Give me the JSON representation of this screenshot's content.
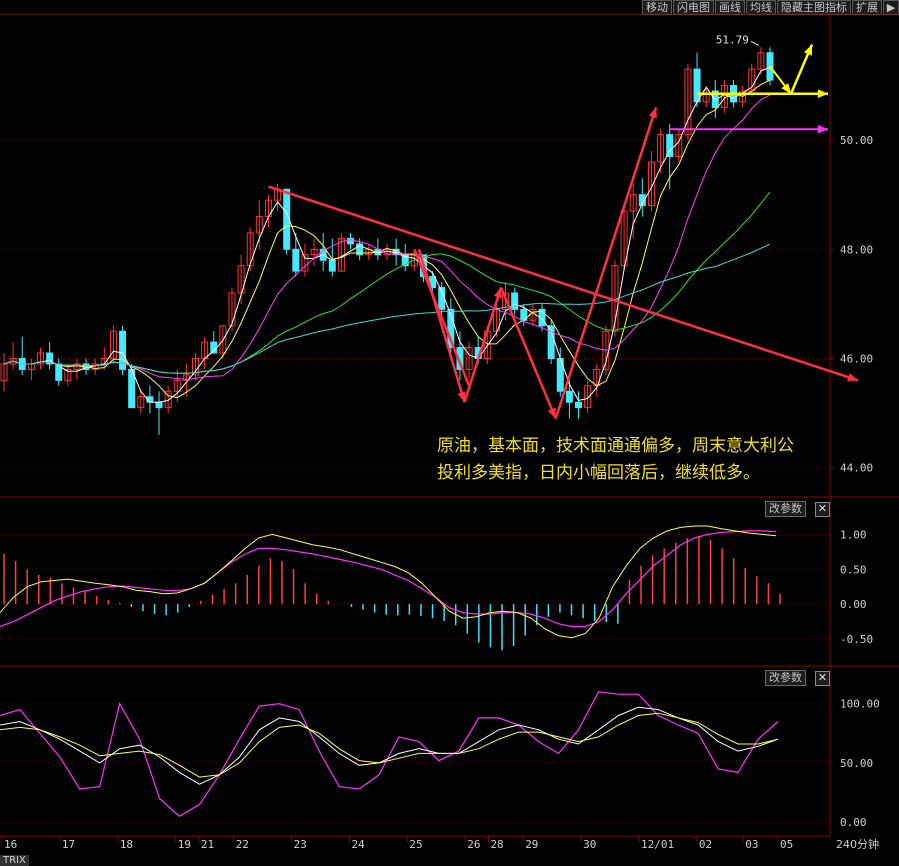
{
  "toolbar": {
    "buttons": [
      "移动",
      "闪电图",
      "画线",
      "均线",
      "隐藏主图指标",
      "扩展"
    ],
    "arrow": "▶"
  },
  "annotation": {
    "line1": "原油，基本面，技术面通通偏多，周末意大利公",
    "line2": "投利多美指，日内小幅回落后，继续低多。"
  },
  "panels": {
    "param_label": "改参数",
    "close_label": "✕",
    "trix_label": "TRIX",
    "period_label": "240分钟"
  },
  "colors": {
    "background": "#000000",
    "up": "#ff3333",
    "down": "#44e8ff",
    "trend_arrow": "#ff3040",
    "yellow_arrow": "#ffff00",
    "magenta_arrow": "#ff30ff",
    "ma_white": "#ffffff",
    "ma_yellow": "#ffff40",
    "ma_magenta": "#ff40ff",
    "ma_green": "#30e030",
    "ma_cyan": "#40d8d8"
  },
  "chart_data": [
    {
      "type": "candlestick",
      "title": "",
      "ylim": [
        43.5,
        52.2
      ],
      "yticks": [
        "44.00",
        "46.00",
        "48.00",
        "50.00"
      ],
      "high_label": "51.79",
      "candles": [
        [
          45.6,
          46.1,
          45.4,
          45.9
        ],
        [
          45.9,
          46.3,
          45.8,
          46.0
        ],
        [
          46.0,
          46.4,
          45.7,
          45.8
        ],
        [
          45.8,
          46.0,
          45.6,
          45.9
        ],
        [
          45.9,
          46.2,
          45.8,
          46.1
        ],
        [
          46.1,
          46.3,
          45.8,
          45.9
        ],
        [
          45.9,
          46.0,
          45.5,
          45.6
        ],
        [
          45.6,
          45.9,
          45.5,
          45.8
        ],
        [
          45.8,
          46.0,
          45.6,
          45.9
        ],
        [
          45.9,
          46.0,
          45.7,
          45.8
        ],
        [
          45.8,
          46.0,
          45.7,
          45.9
        ],
        [
          45.9,
          46.2,
          45.8,
          46.0
        ],
        [
          46.0,
          46.6,
          45.9,
          46.5
        ],
        [
          46.5,
          46.6,
          45.7,
          45.8
        ],
        [
          45.8,
          45.9,
          45.1,
          45.1
        ],
        [
          45.1,
          45.4,
          45.0,
          45.3
        ],
        [
          45.3,
          45.5,
          45.0,
          45.2
        ],
        [
          45.2,
          45.4,
          44.6,
          45.1
        ],
        [
          45.1,
          45.5,
          45.0,
          45.4
        ],
        [
          45.4,
          45.8,
          45.2,
          45.6
        ],
        [
          45.6,
          45.9,
          45.3,
          45.7
        ],
        [
          45.7,
          46.1,
          45.6,
          46.0
        ],
        [
          46.0,
          46.4,
          45.8,
          46.3
        ],
        [
          46.3,
          46.5,
          46.1,
          46.1
        ],
        [
          46.1,
          46.6,
          46.0,
          46.6
        ],
        [
          46.6,
          47.3,
          46.5,
          47.2
        ],
        [
          47.2,
          47.9,
          47.0,
          47.7
        ],
        [
          47.7,
          48.4,
          47.6,
          48.3
        ],
        [
          48.3,
          48.9,
          48.0,
          48.6
        ],
        [
          48.6,
          49.0,
          48.4,
          48.9
        ],
        [
          48.9,
          49.2,
          48.7,
          49.1
        ],
        [
          49.1,
          49.1,
          47.9,
          48.0
        ],
        [
          48.0,
          48.3,
          47.5,
          47.6
        ],
        [
          47.6,
          48.1,
          47.5,
          47.9
        ],
        [
          47.9,
          48.2,
          47.7,
          48.0
        ],
        [
          48.0,
          48.3,
          47.6,
          47.8
        ],
        [
          47.8,
          48.2,
          47.5,
          47.6
        ],
        [
          47.6,
          48.3,
          47.6,
          48.2
        ],
        [
          48.2,
          48.3,
          48.0,
          48.1
        ],
        [
          48.1,
          48.2,
          47.8,
          47.9
        ],
        [
          47.9,
          48.1,
          47.8,
          48.0
        ],
        [
          48.0,
          48.2,
          47.8,
          47.9
        ],
        [
          47.9,
          48.1,
          47.8,
          48.0
        ],
        [
          48.0,
          48.2,
          47.7,
          47.9
        ],
        [
          47.9,
          48.1,
          47.6,
          47.7
        ],
        [
          47.7,
          48.0,
          47.6,
          47.9
        ],
        [
          47.9,
          47.9,
          47.4,
          47.5
        ],
        [
          47.5,
          47.6,
          47.2,
          47.3
        ],
        [
          47.3,
          47.4,
          46.8,
          46.9
        ],
        [
          46.9,
          47.1,
          46.1,
          46.2
        ],
        [
          46.2,
          46.5,
          45.6,
          45.8
        ],
        [
          45.8,
          46.3,
          45.6,
          46.2
        ],
        [
          46.2,
          46.4,
          45.9,
          46.0
        ],
        [
          46.0,
          46.6,
          45.9,
          46.5
        ],
        [
          46.5,
          47.0,
          46.4,
          46.9
        ],
        [
          46.9,
          47.4,
          46.7,
          47.2
        ],
        [
          47.2,
          47.3,
          46.8,
          46.9
        ],
        [
          46.9,
          47.0,
          46.6,
          46.7
        ],
        [
          46.7,
          47.0,
          46.6,
          46.9
        ],
        [
          46.9,
          47.0,
          46.5,
          46.6
        ],
        [
          46.6,
          46.7,
          45.9,
          46.0
        ],
        [
          46.0,
          46.2,
          45.3,
          45.4
        ],
        [
          45.4,
          45.6,
          44.9,
          45.2
        ],
        [
          45.2,
          45.4,
          44.9,
          45.1
        ],
        [
          45.1,
          45.6,
          45.0,
          45.5
        ],
        [
          45.5,
          45.9,
          45.3,
          45.8
        ],
        [
          45.8,
          46.6,
          45.7,
          46.5
        ],
        [
          46.5,
          47.8,
          46.4,
          47.7
        ],
        [
          47.7,
          48.8,
          47.6,
          48.7
        ],
        [
          48.7,
          49.2,
          48.2,
          49.0
        ],
        [
          49.0,
          49.3,
          48.6,
          48.8
        ],
        [
          48.8,
          49.8,
          48.7,
          49.6
        ],
        [
          49.6,
          50.2,
          49.4,
          50.1
        ],
        [
          50.1,
          50.3,
          49.1,
          49.7
        ],
        [
          49.7,
          50.2,
          49.6,
          50.1
        ],
        [
          50.1,
          51.4,
          50.0,
          51.3
        ],
        [
          51.3,
          51.6,
          50.6,
          50.7
        ],
        [
          50.7,
          51.0,
          50.6,
          50.9
        ],
        [
          50.9,
          51.1,
          50.4,
          50.6
        ],
        [
          50.6,
          51.1,
          50.5,
          51.0
        ],
        [
          51.0,
          51.1,
          50.6,
          50.7
        ],
        [
          50.7,
          51.0,
          50.6,
          50.9
        ],
        [
          50.9,
          51.4,
          50.8,
          51.3
        ],
        [
          51.3,
          51.7,
          51.2,
          51.6
        ],
        [
          51.6,
          51.7,
          51.0,
          51.1
        ]
      ],
      "x_tick_labels": [
        "16",
        "17",
        "18",
        "19",
        "21",
        "22",
        "23",
        "24",
        "25",
        "26",
        "28",
        "29",
        "30",
        "12/01",
        "02",
        "03",
        "05"
      ],
      "x_tick_index": [
        0,
        5,
        10,
        15,
        17,
        20,
        25,
        30,
        35,
        40,
        42,
        45,
        50,
        55,
        60,
        64,
        67
      ]
    },
    {
      "type": "macd",
      "ylim": [
        -0.8,
        1.35
      ],
      "yticks": [
        "1.00",
        "0.50",
        "0.00",
        "-0.50"
      ],
      "hist": [
        0.72,
        0.62,
        0.5,
        0.42,
        0.38,
        0.3,
        0.24,
        0.18,
        0.12,
        0.06,
        0.02,
        -0.04,
        -0.1,
        -0.14,
        -0.16,
        -0.12,
        -0.04,
        0.05,
        0.14,
        0.22,
        0.3,
        0.42,
        0.55,
        0.66,
        0.62,
        0.5,
        0.3,
        0.15,
        0.05,
        0.0,
        -0.04,
        -0.08,
        -0.12,
        -0.15,
        -0.16,
        -0.15,
        -0.17,
        -0.2,
        -0.24,
        -0.3,
        -0.42,
        -0.55,
        -0.62,
        -0.66,
        -0.6,
        -0.45,
        -0.3,
        -0.18,
        -0.12,
        -0.16,
        -0.2,
        -0.24,
        -0.26,
        -0.28,
        0.35,
        0.55,
        0.7,
        0.8,
        0.88,
        0.95,
        0.98,
        0.92,
        0.8,
        0.66,
        0.52,
        0.4,
        0.3,
        0.15
      ],
      "diff": [
        -0.12,
        0.1,
        0.25,
        0.32,
        0.34,
        0.36,
        0.33,
        0.3,
        0.28,
        0.25,
        0.2,
        0.18,
        0.15,
        0.16,
        0.22,
        0.3,
        0.45,
        0.62,
        0.8,
        0.95,
        1.0,
        0.95,
        0.9,
        0.85,
        0.82,
        0.78,
        0.72,
        0.66,
        0.6,
        0.54,
        0.45,
        0.3,
        0.1,
        -0.1,
        -0.2,
        -0.18,
        -0.12,
        -0.1,
        -0.12,
        -0.2,
        -0.35,
        -0.45,
        -0.48,
        -0.42,
        -0.2,
        0.25,
        0.55,
        0.8,
        0.95,
        1.05,
        1.1,
        1.12,
        1.12,
        1.08,
        1.05,
        1.02,
        1.0,
        0.98
      ],
      "dea": [
        -0.32,
        -0.25,
        -0.15,
        -0.05,
        0.05,
        0.12,
        0.18,
        0.22,
        0.25,
        0.26,
        0.24,
        0.22,
        0.2,
        0.19,
        0.22,
        0.3,
        0.45,
        0.6,
        0.72,
        0.8,
        0.8,
        0.78,
        0.75,
        0.72,
        0.68,
        0.64,
        0.6,
        0.55,
        0.5,
        0.42,
        0.34,
        0.22,
        0.1,
        -0.05,
        -0.12,
        -0.14,
        -0.14,
        -0.12,
        -0.12,
        -0.14,
        -0.2,
        -0.28,
        -0.32,
        -0.32,
        -0.25,
        -0.08,
        0.15,
        0.35,
        0.55,
        0.7,
        0.85,
        0.95,
        1.0,
        1.03,
        1.04,
        1.05,
        1.05,
        1.04
      ]
    },
    {
      "type": "trix",
      "ylim": [
        -10,
        120
      ],
      "yticks": [
        "100.00",
        "50.00",
        "0.00"
      ],
      "trix": [
        90,
        95,
        75,
        55,
        28,
        30,
        100,
        70,
        20,
        5,
        15,
        40,
        70,
        98,
        100,
        95,
        60,
        30,
        28,
        40,
        72,
        68,
        52,
        60,
        88,
        88,
        82,
        68,
        58,
        78,
        110,
        108,
        108,
        90,
        82,
        75,
        45,
        42,
        70,
        85
      ],
      "matrix": [
        82,
        85,
        78,
        70,
        60,
        50,
        62,
        65,
        55,
        42,
        32,
        40,
        55,
        78,
        88,
        85,
        72,
        58,
        48,
        50,
        58,
        62,
        58,
        58,
        68,
        78,
        82,
        78,
        70,
        66,
        78,
        90,
        97,
        95,
        88,
        82,
        68,
        60,
        64,
        70
      ],
      "signal": [
        78,
        80,
        78,
        72,
        65,
        56,
        58,
        60,
        57,
        48,
        38,
        40,
        50,
        68,
        80,
        82,
        75,
        62,
        52,
        50,
        54,
        58,
        58,
        58,
        62,
        70,
        76,
        76,
        72,
        68,
        72,
        82,
        90,
        92,
        88,
        84,
        74,
        66,
        66,
        70
      ]
    }
  ]
}
